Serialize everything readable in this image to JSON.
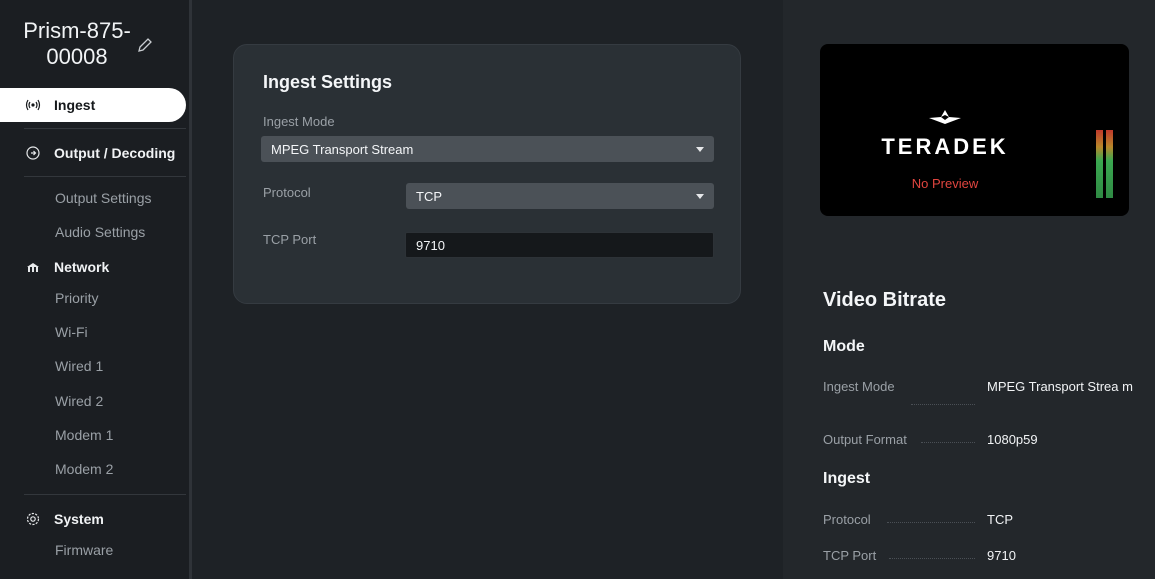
{
  "device": {
    "name": "Prism-875-00008"
  },
  "sidebar": {
    "ingest": "Ingest",
    "output": "Output / Decoding",
    "output_settings": "Output Settings",
    "audio_settings": "Audio Settings",
    "network": "Network",
    "priority": "Priority",
    "wifi": "Wi-Fi",
    "wired1": "Wired 1",
    "wired2": "Wired 2",
    "modem1": "Modem 1",
    "modem2": "Modem 2",
    "system": "System",
    "firmware": "Firmware"
  },
  "ingest_settings": {
    "title": "Ingest Settings",
    "mode_label": "Ingest Mode",
    "mode_value": "MPEG Transport Stream",
    "protocol_label": "Protocol",
    "protocol_value": "TCP",
    "port_label": "TCP Port",
    "port_value": "9710"
  },
  "preview": {
    "brand": "TERADEK",
    "status": "No Preview"
  },
  "summary": {
    "title": "Video Bitrate",
    "mode_heading": "Mode",
    "ingest_mode_label": "Ingest Mode",
    "ingest_mode_value": "MPEG Transport Strea m",
    "output_format_label": "Output Format",
    "output_format_value": "1080p59",
    "ingest_heading": "Ingest",
    "protocol_label": "Protocol",
    "protocol_value": "TCP",
    "port_label": "TCP Port",
    "port_value": "9710"
  },
  "colors": {
    "accent_active": "#ffffff",
    "alert": "#e0453f",
    "meter_green": "#3aa850",
    "meter_red": "#c0392b"
  }
}
